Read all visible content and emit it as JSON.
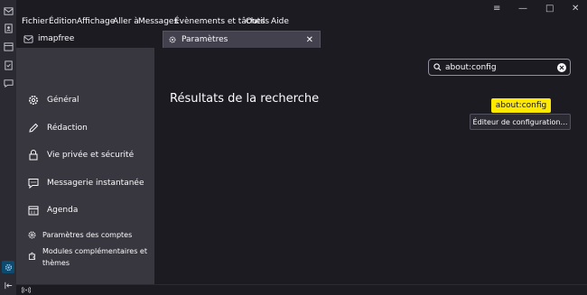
{
  "menu": [
    "Fichier",
    "Édition",
    "Affichage",
    "Aller à",
    "Messages",
    "Évènements et tâches",
    "Outils",
    "Aide"
  ],
  "window_controls": {
    "minimize": "—",
    "maximize": "□",
    "close": "✕",
    "hamburger": "≡"
  },
  "tabs": {
    "account": {
      "label": "imapfree",
      "icon": "account-icon"
    },
    "settings": {
      "label": "Paramètres",
      "icon": "gear-icon",
      "close": "✕"
    }
  },
  "sidebar": {
    "items": [
      {
        "label": "Général",
        "icon": "gear-icon"
      },
      {
        "label": "Rédaction",
        "icon": "pencil-icon"
      },
      {
        "label": "Vie privée et sécurité",
        "icon": "lock-icon"
      },
      {
        "label": "Messagerie instantanée",
        "icon": "chat-icon"
      },
      {
        "label": "Agenda",
        "icon": "calendar-icon"
      }
    ],
    "bottom": [
      {
        "label": "Paramètres des comptes",
        "icon": "gear-icon"
      },
      {
        "label_line1": "Modules complémentaires et",
        "label_line2": "thèmes",
        "icon": "puzzle-icon"
      }
    ]
  },
  "search": {
    "value": "about:config",
    "clear_icon": "clear-icon"
  },
  "results": {
    "title": "Résultats de la recherche",
    "highlight": "about:config",
    "button_label": "Éditeur de configuration…"
  },
  "status": {
    "connection_icon": "wifi-icon"
  },
  "colors": {
    "highlight": "#ffe900",
    "accent": "#0c4b6e"
  }
}
